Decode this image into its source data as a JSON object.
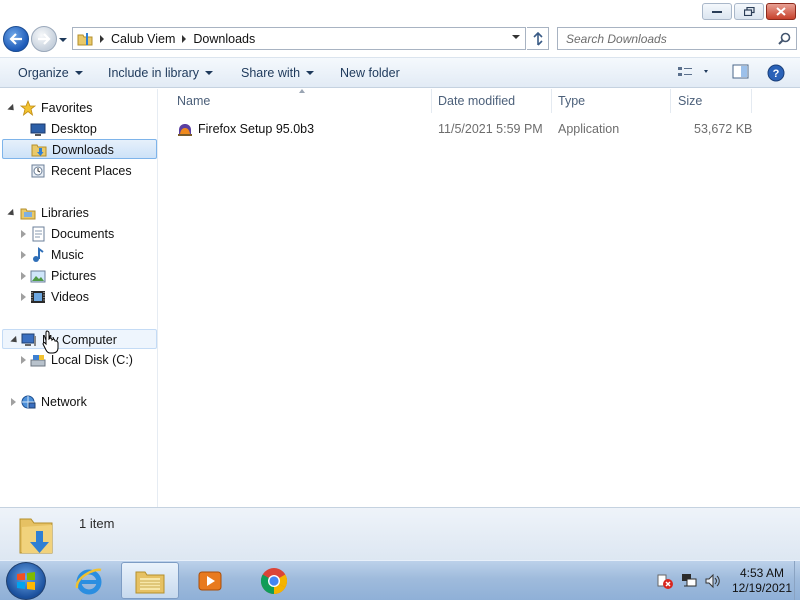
{
  "window": {
    "title_buttons": [
      "minimize",
      "maximize",
      "close"
    ]
  },
  "address": {
    "crumbs": [
      "Calub Viem",
      "Downloads"
    ],
    "search_placeholder": "Search Downloads"
  },
  "toolbar": {
    "organize": "Organize",
    "include_in_library": "Include in library",
    "share_with": "Share with",
    "new_folder": "New folder"
  },
  "nav": {
    "favorites": "Favorites",
    "desktop": "Desktop",
    "downloads": "Downloads",
    "recent_places": "Recent Places",
    "libraries": "Libraries",
    "documents": "Documents",
    "music": "Music",
    "pictures": "Pictures",
    "videos": "Videos",
    "computer": "Computer",
    "computer_prefix": "My",
    "local_disk": "Local Disk (C:)",
    "network": "Network"
  },
  "columns": {
    "name": "Name",
    "date_modified": "Date modified",
    "type": "Type",
    "size": "Size"
  },
  "files": [
    {
      "name": "Firefox Setup 95.0b3",
      "date_modified": "11/5/2021 5:59 PM",
      "type": "Application",
      "size": "53,672 KB"
    }
  ],
  "details": {
    "count": "1 item"
  },
  "taskbar": {
    "apps": [
      "internet-explorer",
      "windows-explorer",
      "media-player",
      "chrome"
    ],
    "time": "4:53 AM",
    "date": "12/19/2021"
  },
  "colors": {
    "accent": "#1e395b",
    "selection": "#cde2f8"
  }
}
